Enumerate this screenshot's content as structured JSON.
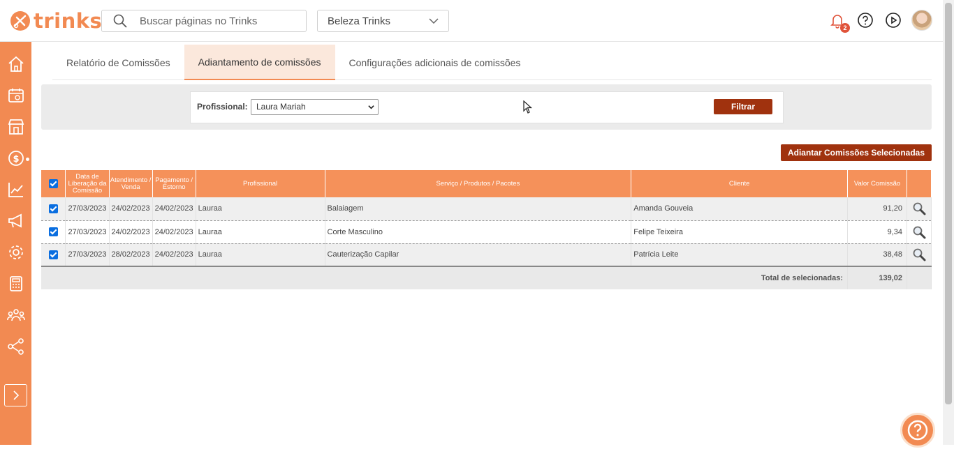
{
  "header": {
    "logo_text": "trinks",
    "search_placeholder": "Buscar páginas no Trinks",
    "establishment": "Beleza Trinks",
    "notification_count": "2"
  },
  "sidebar": {
    "items": [
      "home-icon",
      "agenda-icon",
      "store-icon",
      "money-icon",
      "chart-icon",
      "megaphone-icon",
      "settings-icon",
      "calculator-icon",
      "team-icon",
      "share-icon"
    ]
  },
  "tabs": [
    {
      "label": "Relatório de Comissões",
      "active": false
    },
    {
      "label": "Adiantamento de comissões",
      "active": true
    },
    {
      "label": "Configurações adicionais de comissões",
      "active": false
    }
  ],
  "filter": {
    "label": "Profissional:",
    "selected": "Laura Mariah",
    "button": "Filtrar"
  },
  "advance_button": "Adiantar Comissões Selecionadas",
  "table": {
    "headers": [
      "Data de Liberação da Comissão",
      "Atendimento / Venda",
      "Pagamento / Estorno",
      "Profissional",
      "Serviço / Produtos / Pacotes",
      "Cliente",
      "Valor Comissão"
    ],
    "rows": [
      {
        "liberacao": "27/03/2023",
        "atendimento": "24/02/2023",
        "pagamento": "24/02/2023",
        "profissional": "Lauraa",
        "servico": "Balaiagem",
        "cliente": "Amanda Gouveia",
        "valor": "91,20"
      },
      {
        "liberacao": "27/03/2023",
        "atendimento": "24/02/2023",
        "pagamento": "24/02/2023",
        "profissional": "Lauraa",
        "servico": "Corte Masculino",
        "cliente": "Felipe Teixeira",
        "valor": "9,34"
      },
      {
        "liberacao": "27/03/2023",
        "atendimento": "28/02/2023",
        "pagamento": "24/02/2023",
        "profissional": "Lauraa",
        "servico": "Cauterização Capilar",
        "cliente": "Patrícia Leite",
        "valor": "38,48"
      }
    ],
    "total_label": "Total de selecionadas:",
    "total_value": "139,02"
  },
  "colors": {
    "brand": "#f28a52",
    "button": "#a0320e",
    "checkbox": "#0a6ee0"
  }
}
